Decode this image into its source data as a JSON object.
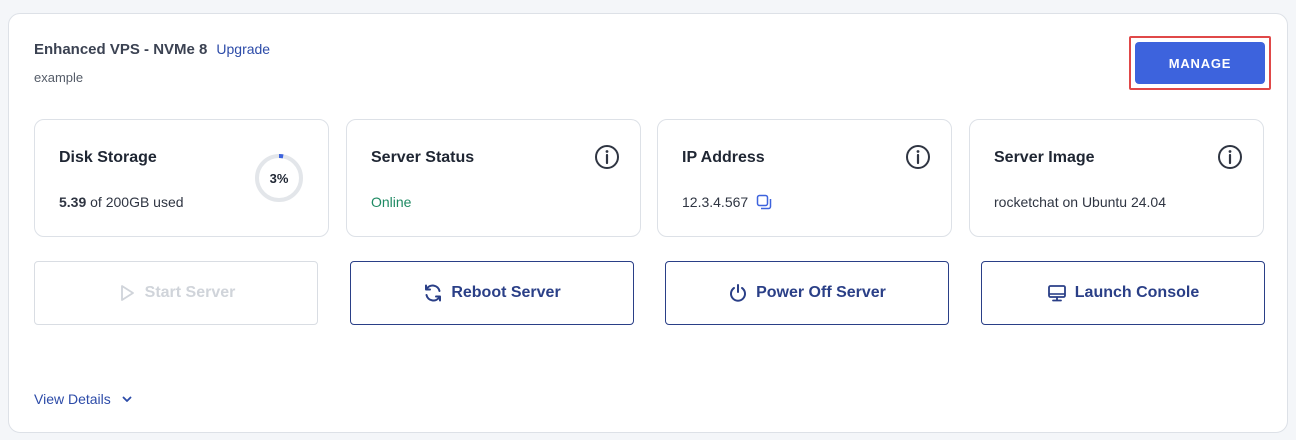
{
  "header": {
    "plan_name": "Enhanced VPS - NVMe 8",
    "upgrade_label": "Upgrade",
    "hostname": "example",
    "manage_label": "MANAGE"
  },
  "tiles": {
    "disk": {
      "title": "Disk Storage",
      "used": "5.39",
      "suffix": "of 200GB used",
      "percent_label": "3%",
      "percent": 0.03
    },
    "status": {
      "title": "Server Status",
      "value": "Online"
    },
    "ip": {
      "title": "IP Address",
      "value": "12.3.4.567"
    },
    "image": {
      "title": "Server Image",
      "value": "rocketchat on Ubuntu 24.04"
    }
  },
  "actions": {
    "start": "Start Server",
    "reboot": "Reboot Server",
    "power_off": "Power Off Server",
    "console": "Launch Console"
  },
  "footer": {
    "view_details": "View Details"
  },
  "colors": {
    "accent": "#3d63dd",
    "navy": "#2a3f87",
    "online": "#1e8a63",
    "highlight": "#e04848"
  }
}
